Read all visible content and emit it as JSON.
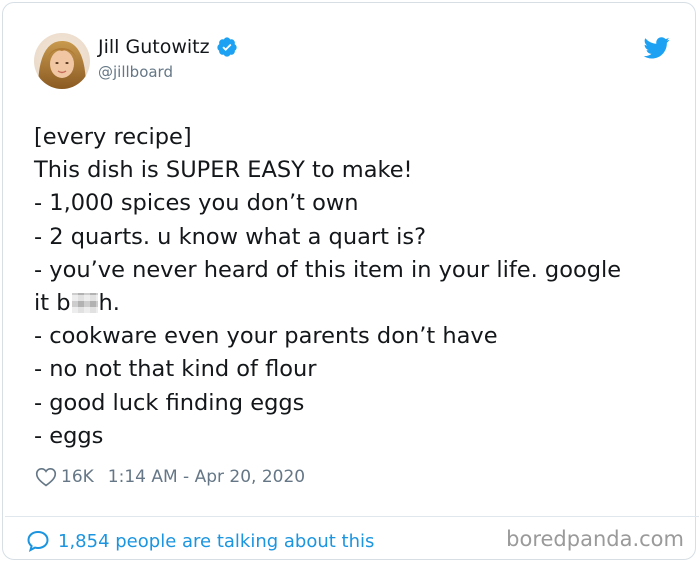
{
  "author": {
    "name": "Jill Gutowitz",
    "handle": "@jillboard",
    "verified": true
  },
  "tweet": {
    "lines": [
      "[every recipe]",
      "This dish is SUPER EASY to make!",
      "- 1,000 spices you don’t own",
      "- 2 quarts. u know what a quart is?",
      "- you’ve never heard of this item in your life. google",
      "- cookware even your parents don’t have",
      "- no not that kind of flour",
      "- good luck finding eggs",
      "- eggs"
    ],
    "censored_prefix": "it b",
    "censored_suffix": "h."
  },
  "meta": {
    "likes": "16K",
    "timestamp": "1:14 AM - Apr 20, 2020"
  },
  "footer": {
    "talking": "1,854 people are talking about this"
  },
  "watermark": "boredpanda.com",
  "icons": {
    "verified": "verified-badge-icon",
    "bird": "twitter-bird-icon",
    "heart": "heart-icon",
    "bubble": "speech-bubble-icon"
  },
  "colors": {
    "twitter_blue": "#1da1f2",
    "link_blue": "#1b95e0",
    "muted_gray": "#657786",
    "text": "#14171a"
  }
}
